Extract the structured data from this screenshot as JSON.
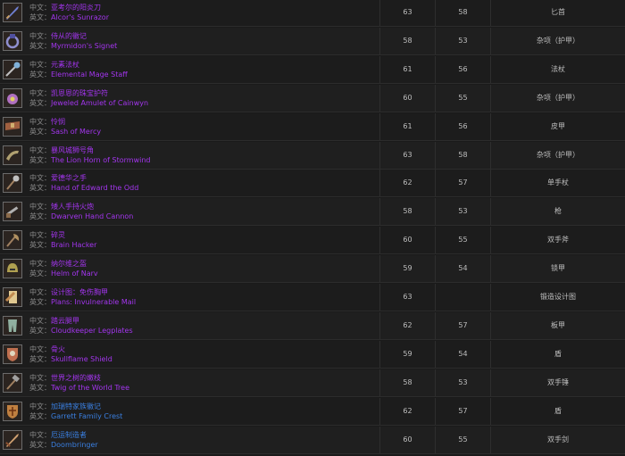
{
  "rows": [
    {
      "cn_label": "中文：",
      "cn": "亚考尔的阳炎刀",
      "en_label": "英文：",
      "en": "Alcor's Sunrazor",
      "level": "63",
      "req": "58",
      "type": "匕首",
      "quality": "purple",
      "icon": "dagger-icon",
      "icon_color": "#6f7fd0"
    },
    {
      "cn_label": "中文：",
      "cn": "侍从的徽记",
      "en_label": "英文：",
      "en": "Myrmidon's Signet",
      "level": "58",
      "req": "53",
      "type": "杂项（护甲）",
      "quality": "purple",
      "icon": "signet-ring-icon",
      "icon_color": "#8f8fcf"
    },
    {
      "cn_label": "中文：",
      "cn": "元素法杖",
      "en_label": "英文：",
      "en": "Elemental Mage Staff",
      "level": "61",
      "req": "56",
      "type": "法杖",
      "quality": "purple",
      "icon": "staff-icon",
      "icon_color": "#7fb0d8"
    },
    {
      "cn_label": "中文：",
      "cn": "凯恩恩的珠宝护符",
      "en_label": "英文：",
      "en": "Jeweled Amulet of Cainwyn",
      "level": "60",
      "req": "55",
      "type": "杂项（护甲）",
      "quality": "purple",
      "icon": "amulet-icon",
      "icon_color": "#b070c0"
    },
    {
      "cn_label": "中文：",
      "cn": "怜悯",
      "en_label": "英文：",
      "en": "Sash of Mercy",
      "level": "61",
      "req": "56",
      "type": "皮甲",
      "quality": "purple",
      "icon": "sash-icon",
      "icon_color": "#a06040"
    },
    {
      "cn_label": "中文：",
      "cn": "暴风城狮号角",
      "en_label": "英文：",
      "en": "The Lion Horn of Stormwind",
      "level": "63",
      "req": "58",
      "type": "杂项（护甲）",
      "quality": "purple",
      "icon": "horn-icon",
      "icon_color": "#b0a070"
    },
    {
      "cn_label": "中文：",
      "cn": "爱德华之手",
      "en_label": "英文：",
      "en": "Hand of Edward the Odd",
      "level": "62",
      "req": "57",
      "type": "单手杖",
      "quality": "purple",
      "icon": "mace-icon",
      "icon_color": "#c0c0c0"
    },
    {
      "cn_label": "中文：",
      "cn": "矮人手持火炮",
      "en_label": "英文：",
      "en": "Dwarven Hand Cannon",
      "level": "58",
      "req": "53",
      "type": "枪",
      "quality": "purple",
      "icon": "gun-icon",
      "icon_color": "#8a6a4a"
    },
    {
      "cn_label": "中文：",
      "cn": "碎灵",
      "en_label": "英文：",
      "en": "Brain Hacker",
      "level": "60",
      "req": "55",
      "type": "双手斧",
      "quality": "purple",
      "icon": "axe-icon",
      "icon_color": "#b09060"
    },
    {
      "cn_label": "中文：",
      "cn": "纳尔维之盔",
      "en_label": "英文：",
      "en": "Helm of Narv",
      "level": "59",
      "req": "54",
      "type": "锁甲",
      "quality": "purple",
      "icon": "helm-icon",
      "icon_color": "#b0a050"
    },
    {
      "cn_label": "中文：",
      "cn": "设计图：免伤胸甲",
      "en_label": "英文：",
      "en": "Plans: Invulnerable Mail",
      "level": "63",
      "req": "",
      "type": "锻造设计图",
      "quality": "purple",
      "icon": "scroll-icon",
      "icon_color": "#c08a50"
    },
    {
      "cn_label": "中文：",
      "cn": "踏云腿甲",
      "en_label": "英文：",
      "en": "Cloudkeeper Legplates",
      "level": "62",
      "req": "57",
      "type": "板甲",
      "quality": "purple",
      "icon": "legplates-icon",
      "icon_color": "#90b0a0"
    },
    {
      "cn_label": "中文：",
      "cn": "骨火",
      "en_label": "英文：",
      "en": "Skullflame Shield",
      "level": "59",
      "req": "54",
      "type": "盾",
      "quality": "purple",
      "icon": "skull-shield-icon",
      "icon_color": "#c07050"
    },
    {
      "cn_label": "中文：",
      "cn": "世界之树的嫩枝",
      "en_label": "英文：",
      "en": "Twig of the World Tree",
      "level": "58",
      "req": "53",
      "type": "双手锤",
      "quality": "purple",
      "icon": "hammer-icon",
      "icon_color": "#a0a0a0"
    },
    {
      "cn_label": "中文：",
      "cn": "加瑞特家族徽记",
      "en_label": "英文：",
      "en": "Garrett Family Crest",
      "level": "62",
      "req": "57",
      "type": "盾",
      "quality": "blue",
      "icon": "crest-shield-icon",
      "icon_color": "#c08040"
    },
    {
      "cn_label": "中文：",
      "cn": "厄运制造者",
      "en_label": "英文：",
      "en": "Doombringer",
      "level": "60",
      "req": "55",
      "type": "双手剑",
      "quality": "blue",
      "icon": "sword-icon",
      "icon_color": "#d0a070"
    }
  ]
}
